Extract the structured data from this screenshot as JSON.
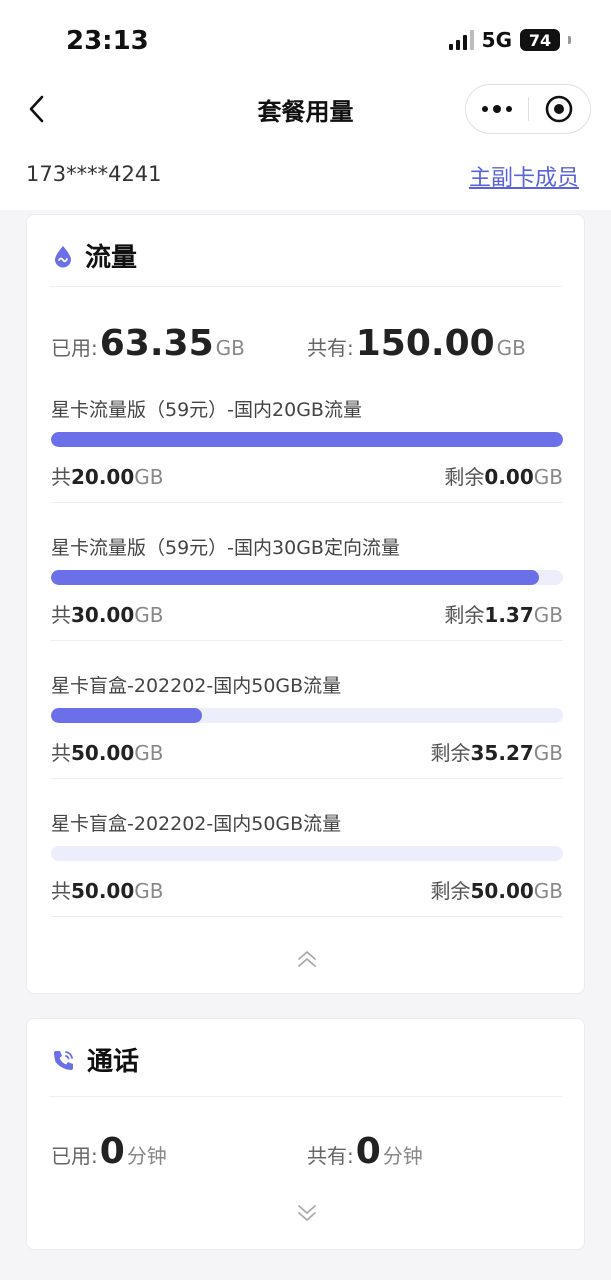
{
  "status_bar": {
    "time": "23:13",
    "network": "5G",
    "battery": "74"
  },
  "nav": {
    "title": "套餐用量"
  },
  "header": {
    "phone": "173****4241",
    "members_link": "主副卡成员"
  },
  "data_card": {
    "title": "流量",
    "used_label": "已用:",
    "used_value": "63.35",
    "used_unit": "GB",
    "total_label": "共有:",
    "total_value": "150.00",
    "total_unit": "GB",
    "packages": [
      {
        "name": "星卡流量版（59元）-国内20GB流量",
        "total_prefix": "共",
        "total": "20.00",
        "unit": "GB",
        "remain_prefix": "剩余",
        "remain": "0.00",
        "used_fraction": 1.0
      },
      {
        "name": "星卡流量版（59元）-国内30GB定向流量",
        "total_prefix": "共",
        "total": "30.00",
        "unit": "GB",
        "remain_prefix": "剩余",
        "remain": "1.37",
        "used_fraction": 0.954
      },
      {
        "name": "星卡盲盒-202202-国内50GB流量",
        "total_prefix": "共",
        "total": "50.00",
        "unit": "GB",
        "remain_prefix": "剩余",
        "remain": "35.27",
        "used_fraction": 0.295
      },
      {
        "name": "星卡盲盒-202202-国内50GB流量",
        "total_prefix": "共",
        "total": "50.00",
        "unit": "GB",
        "remain_prefix": "剩余",
        "remain": "50.00",
        "used_fraction": 0.0
      }
    ]
  },
  "voice_card": {
    "title": "通话",
    "used_label": "已用:",
    "used_value": "0",
    "used_unit": "分钟",
    "total_label": "共有:",
    "total_value": "0",
    "total_unit": "分钟"
  },
  "colors": {
    "accent": "#6c70e8",
    "track": "#eceefc",
    "link": "#5a62d8"
  },
  "icons": {
    "data": "droplet-wave-icon",
    "voice": "phone-call-icon",
    "collapse": "double-chevron-up-icon",
    "expand": "double-chevron-down-icon"
  }
}
